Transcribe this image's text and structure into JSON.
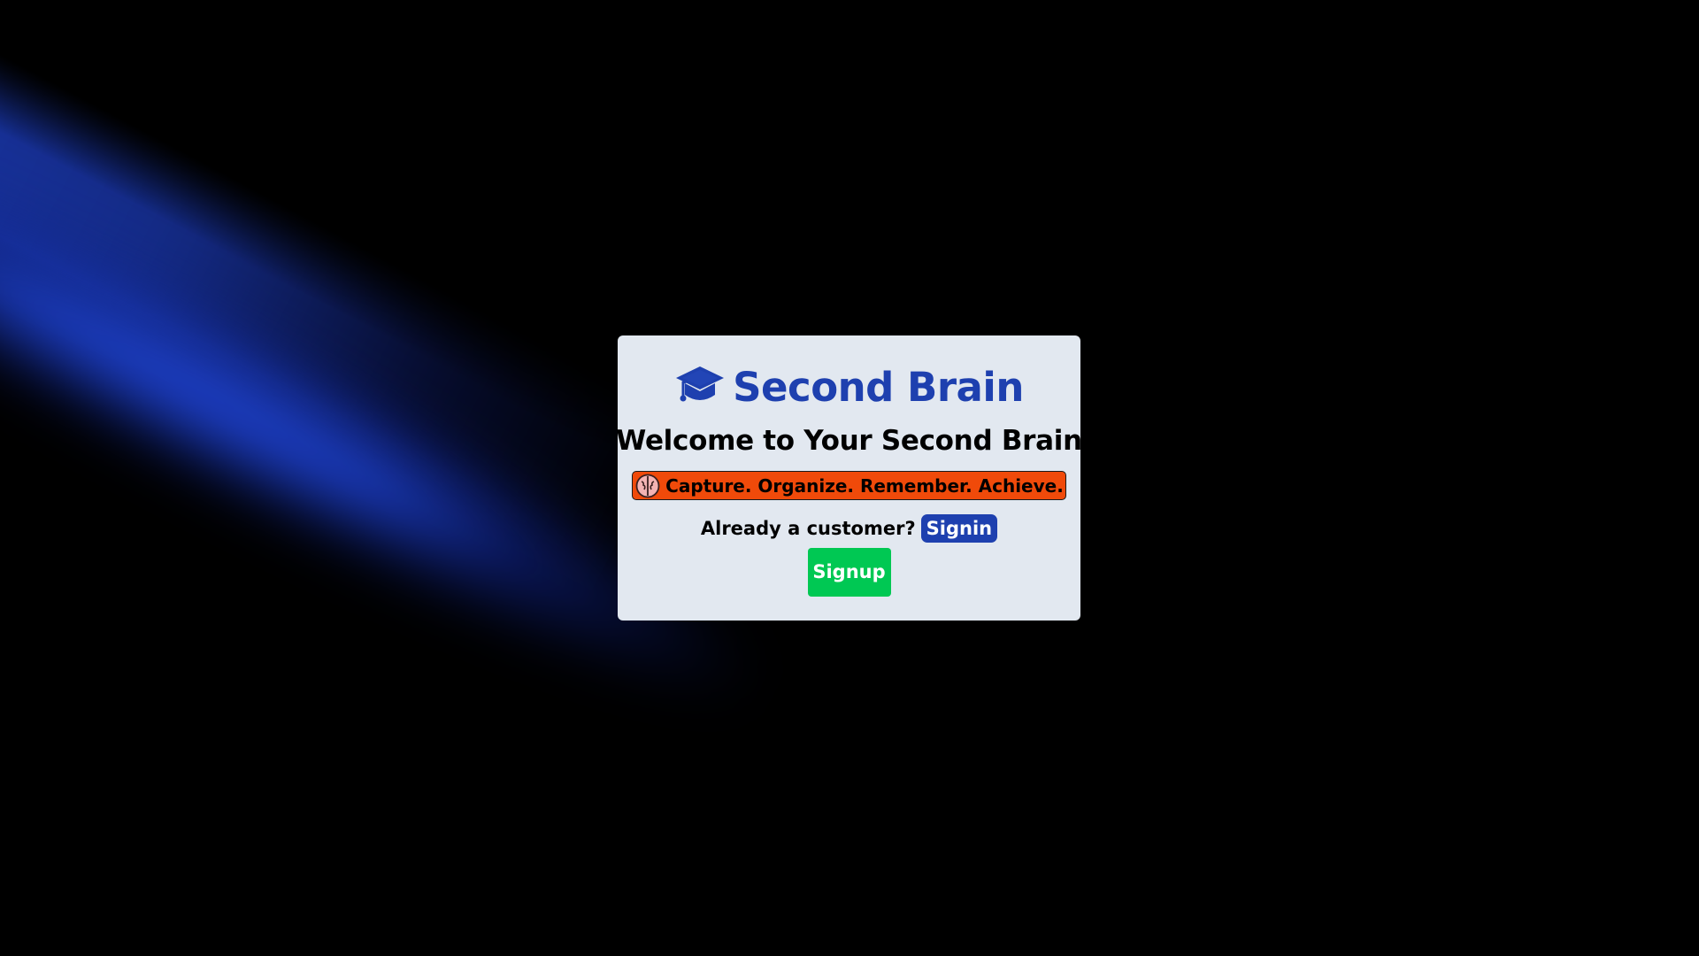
{
  "brand": {
    "name": "Second Brain",
    "icon": "graduation-cap-icon",
    "color": "#1e40af"
  },
  "hero": {
    "heading": "Welcome to Your Second Brain"
  },
  "tagline": {
    "icon": "brain-icon",
    "text": "Capture. Organize. Remember. Achieve.",
    "background": "#f04a0a"
  },
  "auth": {
    "signin_prompt": "Already a customer?",
    "signin_label": "Signin",
    "signup_label": "Signup"
  },
  "theme": {
    "background": "#000000",
    "card": "#e2e8f0",
    "accent_blue": "#1e40af",
    "accent_green": "#00c853"
  }
}
